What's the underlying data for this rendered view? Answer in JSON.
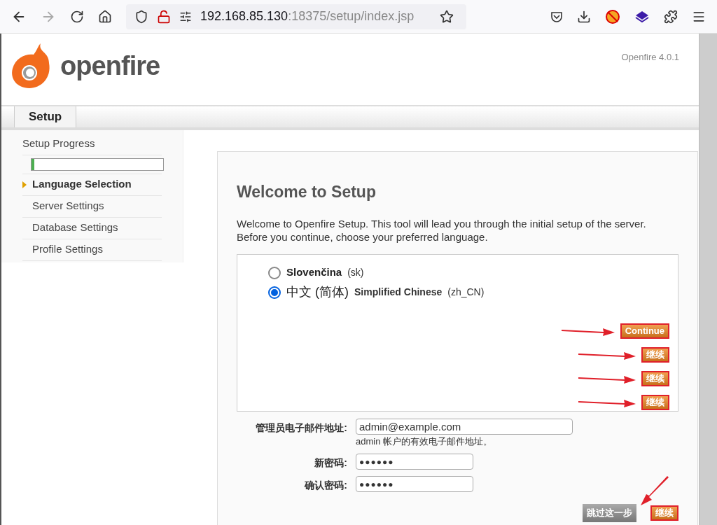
{
  "browser": {
    "forward_disabled": true,
    "address": {
      "host": "192.168.85.130",
      "path": ":18375/setup/index.jsp"
    }
  },
  "header": {
    "logo_text": "openfire",
    "version": "Openfire 4.0.1"
  },
  "tabs": [
    {
      "label": "Setup",
      "selected": true
    }
  ],
  "sidebar": {
    "title": "Setup Progress",
    "progress": {
      "level": 0.02
    },
    "items": [
      {
        "label": "Language Selection",
        "selected": true
      },
      {
        "label": "Server Settings",
        "selected": false
      },
      {
        "label": "Database Settings",
        "selected": false
      },
      {
        "label": "Profile Settings",
        "selected": false
      }
    ]
  },
  "content": {
    "title": "Welcome to Setup",
    "intro": "Welcome to Openfire Setup. This tool will lead you through the initial setup of the server. Before you continue, choose your preferred language.",
    "languages": [
      {
        "native": "Slovenčina",
        "code": "(sk)",
        "selected": false
      },
      {
        "native": "中文 (简体)",
        "english": "Simplified Chinese",
        "code": "(zh_CN)",
        "selected": true
      }
    ],
    "continue_buttons": [
      "Continue",
      "继续",
      "继续",
      "继续"
    ],
    "fields": [
      {
        "label": "管理员电子邮件地址:",
        "value": "admin@example.com",
        "hint": "admin 帐户的有效电子邮件地址。",
        "kind": "text"
      },
      {
        "label": "新密码:",
        "value": "●●●●●●",
        "kind": "password"
      },
      {
        "label": "确认密码:",
        "value": "●●●●●●",
        "kind": "password"
      }
    ],
    "skip_button": "跳过这一步",
    "final_button": "继续"
  }
}
